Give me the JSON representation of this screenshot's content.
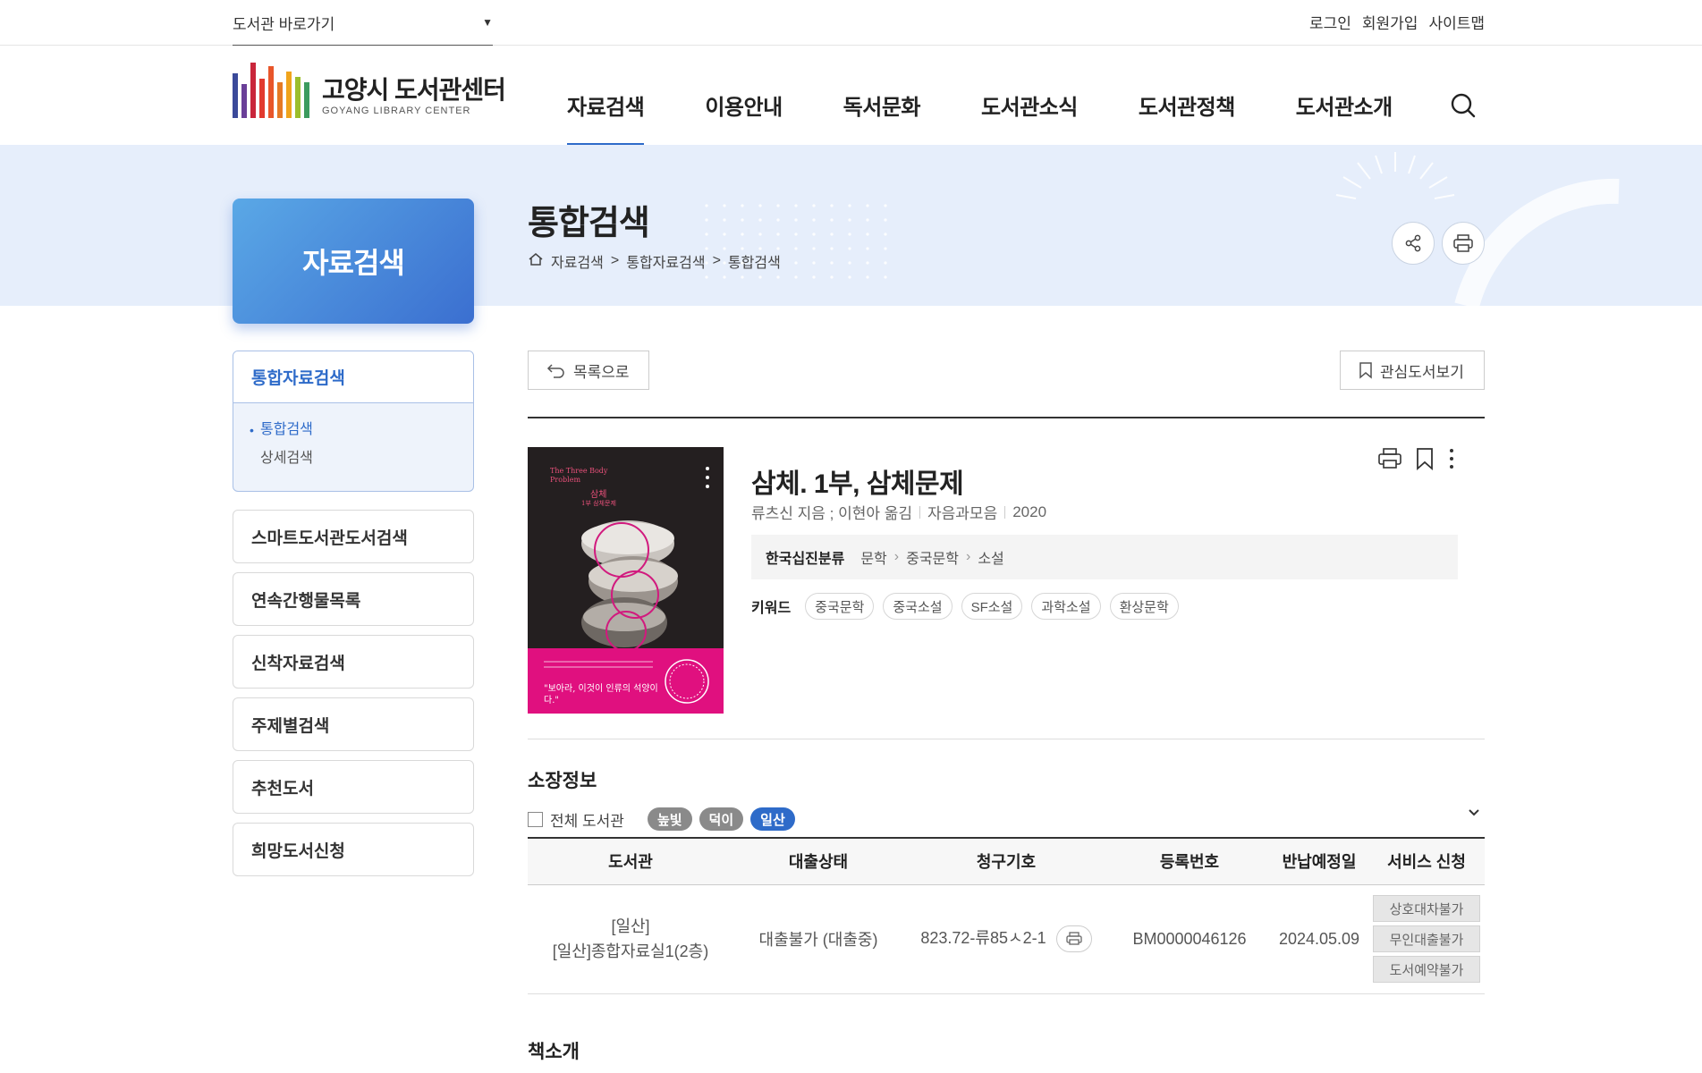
{
  "topbar": {
    "library_select": "도서관 바로가기",
    "links": [
      "로그인",
      "회원가입",
      "사이트맵"
    ]
  },
  "logo": {
    "name_ko": "고양시 도서관센터",
    "name_en": "GOYANG LIBRARY CENTER",
    "bar_colors": [
      "#3b4a9a",
      "#6a3f98",
      "#c9263b",
      "#e23a2f",
      "#e8562a",
      "#e57a25",
      "#f0a41c",
      "#9cbe2b",
      "#3c9b5e"
    ]
  },
  "gnb": {
    "items": [
      "자료검색",
      "이용안내",
      "독서문화",
      "도서관소식",
      "도서관정책",
      "도서관소개"
    ],
    "active": "자료검색",
    "accent": "#2e6bc9"
  },
  "side_title": "자료검색",
  "page": {
    "title": "통합검색",
    "breadcrumb": [
      "자료검색",
      "통합자료검색",
      "통합검색"
    ],
    "separator": ">"
  },
  "lnb": {
    "group_title": "통합자료검색",
    "sub_items": [
      "통합검색",
      "상세검색"
    ],
    "items": [
      "스마트도서관도서검색",
      "연속간행물목록",
      "신착자료검색",
      "주제별검색",
      "추천도서",
      "희망도서신청"
    ]
  },
  "actions": {
    "back_label": "목록으로",
    "wishlist_label": "관심도서보기"
  },
  "book": {
    "title": "삼체. 1부, 삼체문제",
    "author": "류츠신 지음 ; 이현아 옮김",
    "publisher": "자음과모음",
    "year": "2020",
    "kdc_label": "한국십진분류",
    "kdc_path": [
      "문학",
      "중국문학",
      "소설"
    ],
    "keyword_label": "키워드",
    "keywords": [
      "중국문학",
      "중국소설",
      "SF소설",
      "과학소설",
      "환상문학"
    ],
    "cover": {
      "en_title": "The Three Body Problem",
      "ko_title": "삼체",
      "subtitle": "1부 삼체문제",
      "quote": "\"보아라, 이것이 인류의 석양이다.\""
    }
  },
  "holdings": {
    "section_title": "소장정보",
    "all_label": "전체 도서관",
    "branches": [
      {
        "name": "높빛",
        "color": "#8a8a8a"
      },
      {
        "name": "덕이",
        "color": "#8a8a8a"
      },
      {
        "name": "일산",
        "color": "#2e6bc9"
      }
    ],
    "columns": [
      "도서관",
      "대출상태",
      "청구기호",
      "등록번호",
      "반납예정일",
      "서비스 신청"
    ],
    "rows": [
      {
        "library": "[일산]",
        "location": "[일산]종합자료실1(2층)",
        "status": "대출불가 (대출중)",
        "call_no": "823.72-류85ㅅ2-1",
        "reg_no": "BM0000046126",
        "due": "2024.05.09",
        "services": [
          "상호대차불가",
          "무인대출불가",
          "도서예약불가"
        ]
      }
    ]
  },
  "intro_title": "책소개"
}
